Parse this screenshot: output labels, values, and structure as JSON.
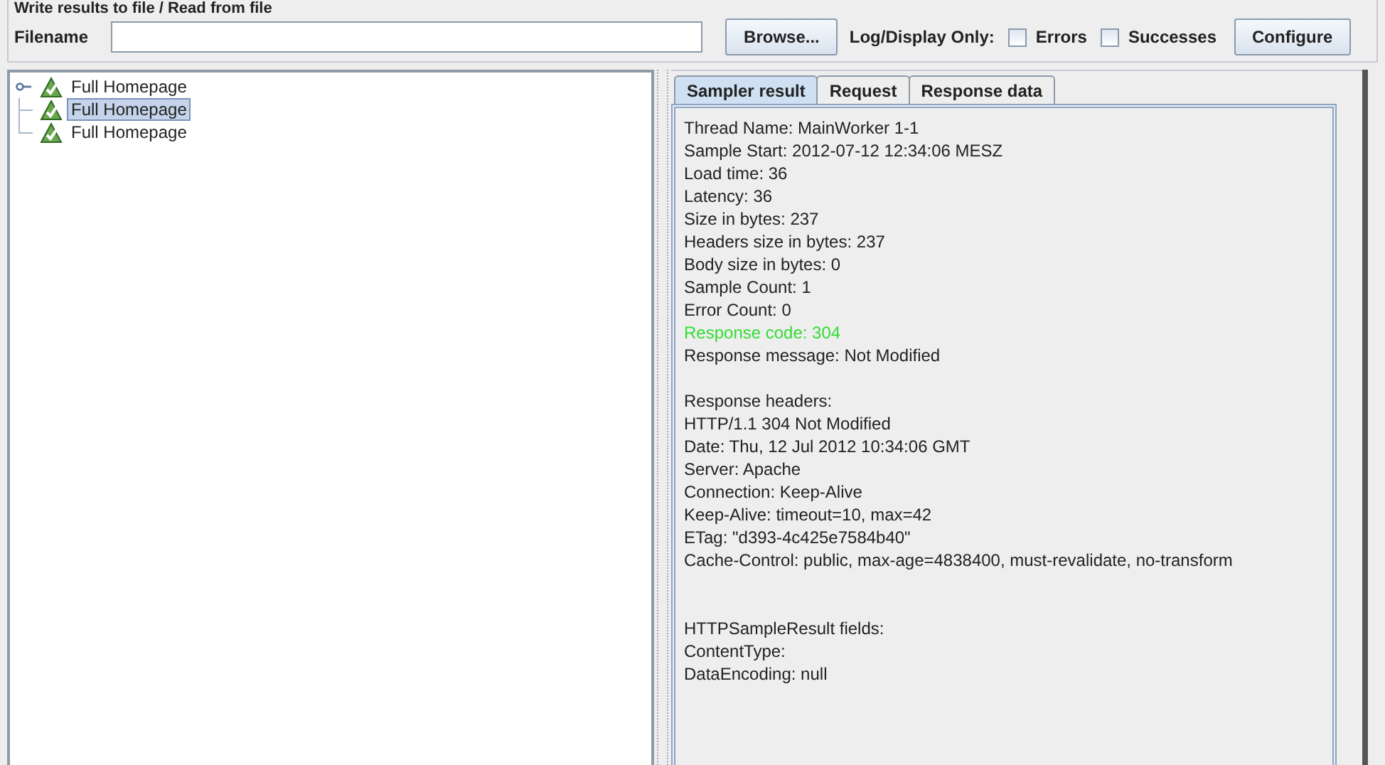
{
  "file_panel": {
    "title": "Write results to file / Read from file",
    "filename_label": "Filename",
    "browse_button": "Browse...",
    "log_label": "Log/Display Only:",
    "options": [
      {
        "label": "Errors",
        "checked": false
      },
      {
        "label": "Successes",
        "checked": false
      }
    ],
    "configure_button": "Configure"
  },
  "tree": {
    "expanded": true,
    "items": [
      {
        "label": "Full Homepage",
        "selected": false
      },
      {
        "label": "Full Homepage",
        "selected": true
      },
      {
        "label": "Full Homepage",
        "selected": false
      }
    ]
  },
  "tabs": [
    {
      "label": "Sampler result",
      "selected": true
    },
    {
      "label": "Request",
      "selected": false
    },
    {
      "label": "Response data",
      "selected": false
    }
  ],
  "result_lines": [
    {
      "kind": "line",
      "text": "Thread Name: MainWorker 1-1"
    },
    {
      "kind": "line",
      "text": "Sample Start: 2012-07-12 12:34:06 MESZ"
    },
    {
      "kind": "line",
      "text": "Load time: 36"
    },
    {
      "kind": "line",
      "text": "Latency: 36"
    },
    {
      "kind": "line",
      "text": "Size in bytes: 237"
    },
    {
      "kind": "line",
      "text": "Headers size in bytes: 237"
    },
    {
      "kind": "line",
      "text": "Body size in bytes: 0"
    },
    {
      "kind": "line",
      "text": "Sample Count: 1"
    },
    {
      "kind": "line",
      "text": "Error Count: 0"
    },
    {
      "kind": "success",
      "text": "Response code: 304"
    },
    {
      "kind": "line",
      "text": "Response message: Not Modified"
    },
    {
      "kind": "gap"
    },
    {
      "kind": "line",
      "text": "Response headers:"
    },
    {
      "kind": "line",
      "text": "HTTP/1.1 304 Not Modified"
    },
    {
      "kind": "line",
      "text": "Date: Thu, 12 Jul 2012 10:34:06 GMT"
    },
    {
      "kind": "line",
      "text": "Server: Apache"
    },
    {
      "kind": "line",
      "text": "Connection: Keep-Alive"
    },
    {
      "kind": "line",
      "text": "Keep-Alive: timeout=10, max=42"
    },
    {
      "kind": "line",
      "text": "ETag: \"d393-4c425e7584b40\""
    },
    {
      "kind": "line",
      "text": "Cache-Control: public, max-age=4838400, must-revalidate, no-transform"
    },
    {
      "kind": "gap"
    },
    {
      "kind": "gap"
    },
    {
      "kind": "line",
      "text": "HTTPSampleResult fields:"
    },
    {
      "kind": "line",
      "text": "ContentType:"
    },
    {
      "kind": "line",
      "text": "DataEncoding: null"
    }
  ]
}
